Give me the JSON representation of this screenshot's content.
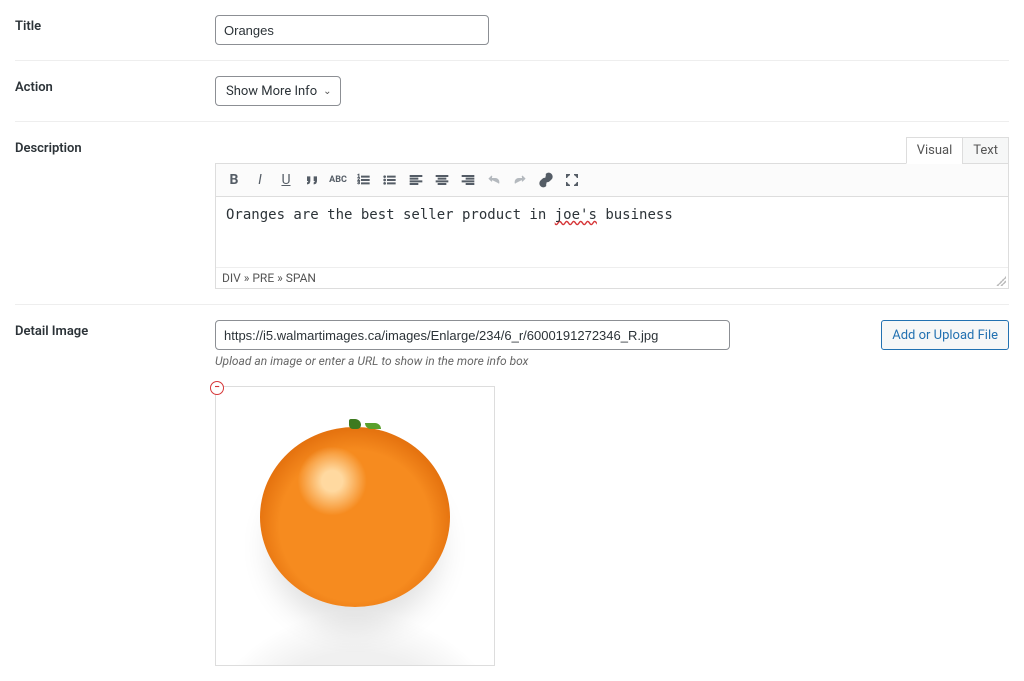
{
  "title": {
    "label": "Title",
    "value": "Oranges"
  },
  "action": {
    "label": "Action",
    "selected": "Show More Info"
  },
  "description": {
    "label": "Description",
    "tabs": {
      "visual": "Visual",
      "text": "Text",
      "active": "visual"
    },
    "content_plain_prefix": "Oranges are the best seller product in ",
    "content_misspelled": "joe's",
    "content_plain_suffix": " business",
    "path": "DIV » PRE » SPAN"
  },
  "detail_image": {
    "label": "Detail Image",
    "url": "https://i5.walmartimages.ca/images/Enlarge/234/6_r/6000191272346_R.jpg",
    "helper": "Upload an image or enter a URL to show in the more info box",
    "button": "Add or Upload File"
  }
}
